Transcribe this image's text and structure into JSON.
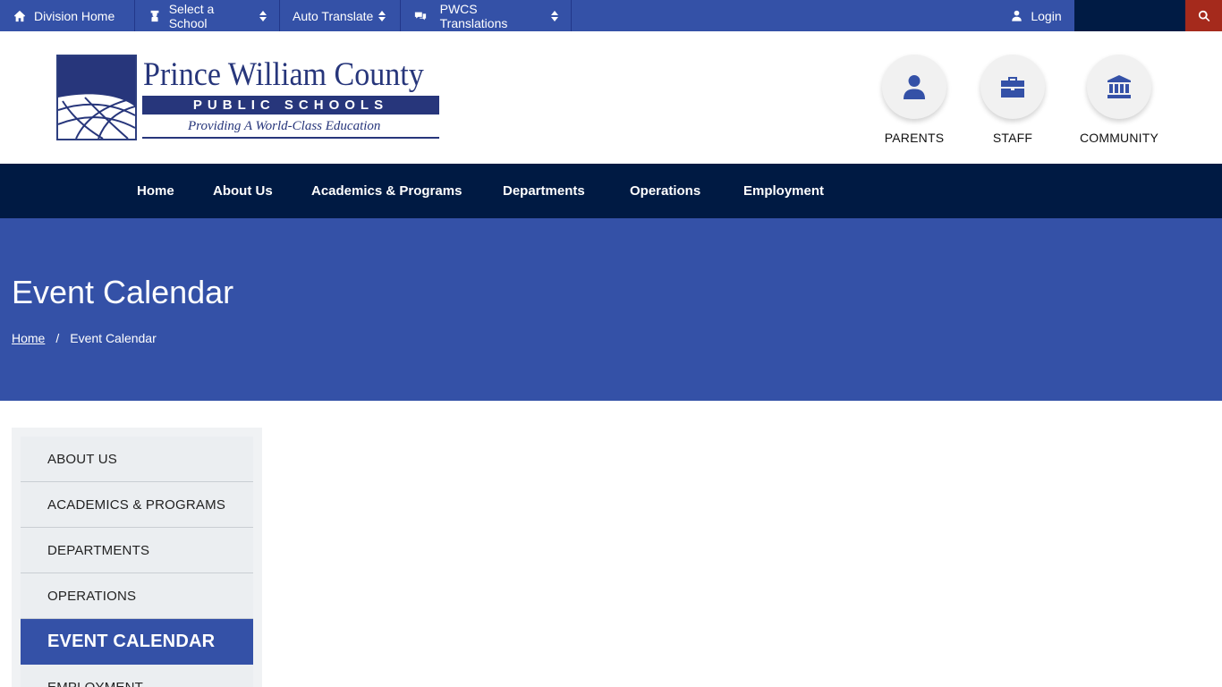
{
  "utility_bar": {
    "division_home": "Division Home",
    "select_school": "Select a School",
    "auto_translate": "Auto Translate",
    "pwcs_translations": "PWCS Translations",
    "login": "Login"
  },
  "logo": {
    "title": "Prince William County",
    "band": "PUBLIC SCHOOLS",
    "tagline": "Providing A World-Class Education"
  },
  "audience": {
    "parents": "PARENTS",
    "staff": "STAFF",
    "community": "COMMUNITY"
  },
  "main_nav": {
    "home": "Home",
    "about": "About Us",
    "academics": "Academics & Programs",
    "departments": "Departments",
    "operations": "Operations",
    "employment": "Employment"
  },
  "banner": {
    "title": "Event Calendar",
    "breadcrumb_home": "Home",
    "breadcrumb_sep": "/",
    "breadcrumb_current": "Event Calendar"
  },
  "sidebar": {
    "items": [
      {
        "label": "ABOUT US"
      },
      {
        "label": "ACADEMICS & PROGRAMS"
      },
      {
        "label": "DEPARTMENTS"
      },
      {
        "label": "OPERATIONS"
      },
      {
        "label": "EVENT CALENDAR"
      },
      {
        "label": "EMPLOYMENT"
      }
    ],
    "active_index": 4
  },
  "colors": {
    "primary_blue": "#3451a7",
    "navy": "#001a43",
    "search_red": "#a52a1c",
    "sidebar_bg": "#ebeef1"
  },
  "icons": {
    "division_home": "home-icon",
    "select_school": "graduate-icon",
    "pwcs_translations": "comments-icon",
    "login": "user-icon",
    "search": "search-icon",
    "parents": "user-icon",
    "staff": "briefcase-icon",
    "community": "landmark-icon"
  }
}
